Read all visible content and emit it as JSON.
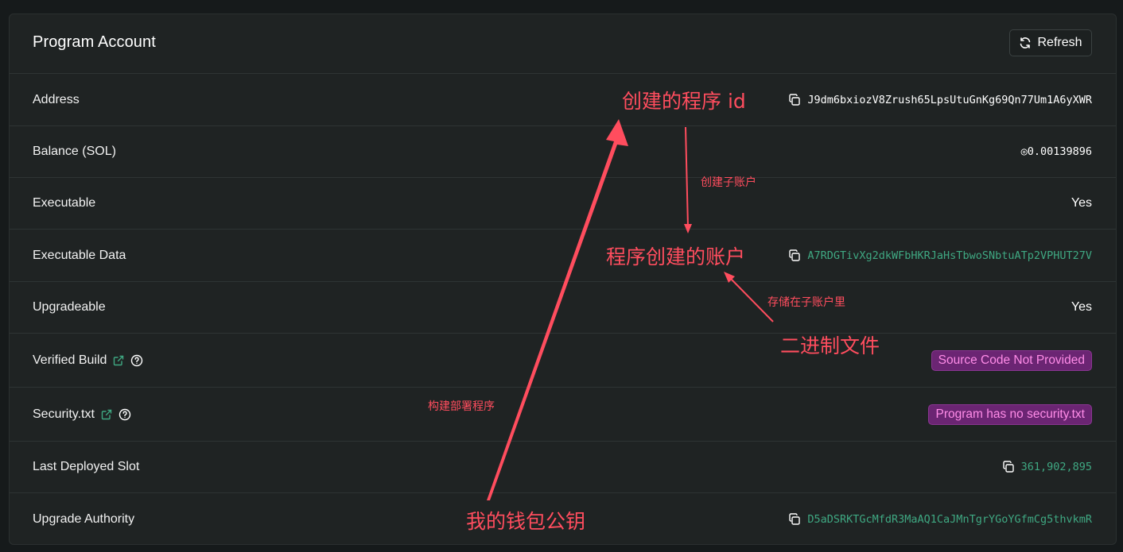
{
  "card": {
    "title": "Program Account",
    "refresh_label": "Refresh"
  },
  "rows": {
    "address": {
      "label": "Address",
      "value": "J9dm6bxiozV8Zrush65LpsUtuGnKg69Qn77Um1A6yXWR"
    },
    "balance": {
      "label": "Balance (SOL)",
      "value": "◎0.00139896"
    },
    "executable": {
      "label": "Executable",
      "value": "Yes"
    },
    "executable_data": {
      "label": "Executable Data",
      "value": "A7RDGTivXg2dkWFbHKRJaHsTbwoSNbtuATp2VPHUT27V"
    },
    "upgradeable": {
      "label": "Upgradeable",
      "value": "Yes"
    },
    "verified_build": {
      "label": "Verified Build",
      "value": "Source Code Not Provided"
    },
    "security_txt": {
      "label": "Security.txt",
      "value": "Program has no security.txt"
    },
    "last_deployed_slot": {
      "label": "Last Deployed Slot",
      "value": "361,902,895"
    },
    "upgrade_authority": {
      "label": "Upgrade Authority",
      "value": "D5aDSRKTGcMfdR3MaAQ1CaJMnTgrYGoYGfmCg5thvkmR"
    }
  },
  "annotations": {
    "program_id": "创建的程序 id",
    "create_sub_account": "创建子账户",
    "program_created_account": "程序创建的账户",
    "stored_in_sub_account": "存储在子账户里",
    "binary_file": "二进制文件",
    "build_deploy_program": "构建部署程序",
    "my_wallet_pubkey": "我的钱包公钥"
  },
  "colors": {
    "background": "#161a1b",
    "card": "#1f2323",
    "accent_green": "#3fa882",
    "badge_bg": "#6b2573",
    "badge_text": "#ff8ce8",
    "annotation_red": "#ff4d5e"
  },
  "icons": {
    "refresh": "refresh-icon",
    "copy": "copy-icon",
    "external_link": "external-link-icon",
    "help": "help-circle-icon"
  }
}
